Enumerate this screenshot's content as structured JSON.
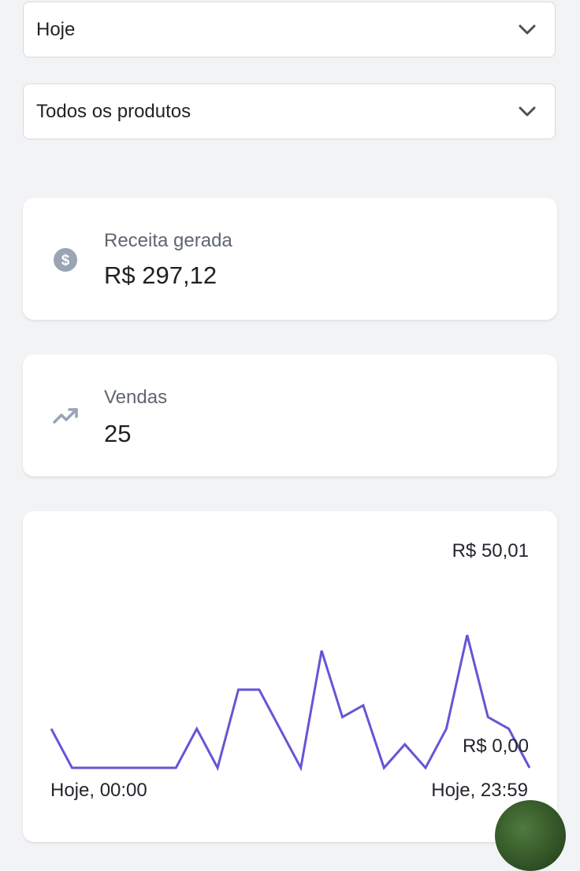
{
  "filters": {
    "period": {
      "value": "Hoje"
    },
    "product": {
      "value": "Todos os produtos"
    }
  },
  "revenue": {
    "label": "Receita gerada",
    "value": "R$ 297,12",
    "icon": "dollar-circle-icon"
  },
  "sales": {
    "label": "Vendas",
    "value": "25",
    "icon": "trending-up-icon"
  },
  "colors": {
    "line": "#6456d6",
    "icon": "#9aa4b5"
  },
  "chart_data": {
    "type": "line",
    "title": "",
    "xlabel": "",
    "ylabel": "",
    "max_label": "R$ 50,01",
    "min_label": "R$ 0,00",
    "x_start_label": "Hoje, 00:00",
    "x_end_label": "Hoje, 23:59",
    "ylim": [
      0,
      50.01
    ],
    "series": [
      {
        "values": [
          10,
          0,
          0,
          0,
          0,
          0,
          0,
          10,
          0,
          20,
          20,
          10,
          0,
          30,
          13,
          16,
          0,
          6,
          0,
          10,
          34,
          13,
          10,
          0
        ]
      }
    ]
  }
}
